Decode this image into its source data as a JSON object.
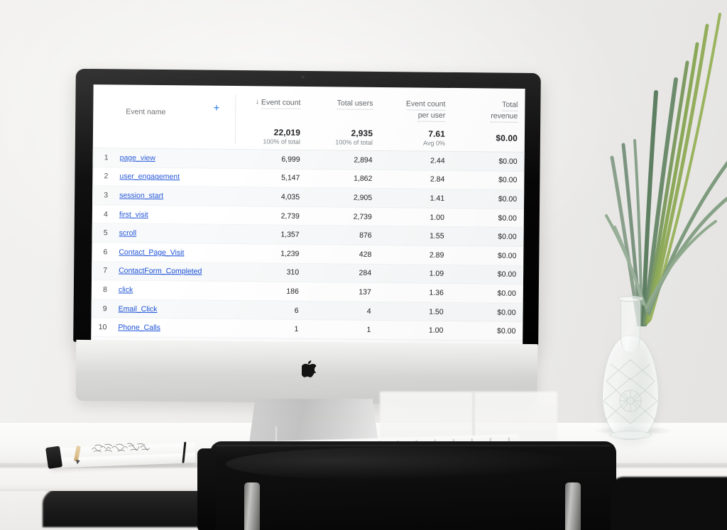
{
  "scene": {
    "device": "imac-desktop-computer",
    "wall_color": "#eeedeb",
    "desk_color": "#f7f6f5"
  },
  "report": {
    "columns": [
      {
        "key": "event_name",
        "label": "Event name",
        "align": "left",
        "sorted": false,
        "dotted_underline": false
      },
      {
        "key": "event_count",
        "label": "Event count",
        "align": "right",
        "sorted": true,
        "sort_direction": "desc",
        "sort_glyph": "↓",
        "dotted_underline": true
      },
      {
        "key": "total_users",
        "label": "Total users",
        "align": "right",
        "sorted": false,
        "dotted_underline": true
      },
      {
        "key": "event_count_per_user",
        "label_line1": "Event count",
        "label_line2": "per user",
        "align": "right",
        "sorted": false,
        "dotted_underline": true
      },
      {
        "key": "total_revenue",
        "label_line1": "Total",
        "label_line2": "revenue",
        "align": "right",
        "sorted": false,
        "dotted_underline": true
      }
    ],
    "add_column_icon": "plus-icon",
    "add_column_color": "#1a73e8",
    "summary": {
      "event_count": {
        "value": "22,019",
        "sub": "100% of total"
      },
      "total_users": {
        "value": "2,935",
        "sub": "100% of total"
      },
      "event_count_per_user": {
        "value": "7.61",
        "sub": "Avg 0%"
      },
      "total_revenue": {
        "value": "$0.00",
        "sub": ""
      }
    },
    "rows": [
      {
        "index": "1",
        "event_name": "page_view",
        "event_count": "6,999",
        "total_users": "2,894",
        "event_count_per_user": "2.44",
        "total_revenue": "$0.00"
      },
      {
        "index": "2",
        "event_name": "user_engagement",
        "event_count": "5,147",
        "total_users": "1,862",
        "event_count_per_user": "2.84",
        "total_revenue": "$0.00"
      },
      {
        "index": "3",
        "event_name": "session_start",
        "event_count": "4,035",
        "total_users": "2,905",
        "event_count_per_user": "1.41",
        "total_revenue": "$0.00"
      },
      {
        "index": "4",
        "event_name": "first_visit",
        "event_count": "2,739",
        "total_users": "2,739",
        "event_count_per_user": "1.00",
        "total_revenue": "$0.00"
      },
      {
        "index": "5",
        "event_name": "scroll",
        "event_count": "1,357",
        "total_users": "876",
        "event_count_per_user": "1.55",
        "total_revenue": "$0.00"
      },
      {
        "index": "6",
        "event_name": "Contact_Page_Visit",
        "event_count": "1,239",
        "total_users": "428",
        "event_count_per_user": "2.89",
        "total_revenue": "$0.00"
      },
      {
        "index": "7",
        "event_name": "ContactForm_Completed",
        "event_count": "310",
        "total_users": "284",
        "event_count_per_user": "1.09",
        "total_revenue": "$0.00"
      },
      {
        "index": "8",
        "event_name": "click",
        "event_count": "186",
        "total_users": "137",
        "event_count_per_user": "1.36",
        "total_revenue": "$0.00"
      },
      {
        "index": "9",
        "event_name": "Email_Click",
        "event_count": "6",
        "total_users": "4",
        "event_count_per_user": "1.50",
        "total_revenue": "$0.00"
      },
      {
        "index": "10",
        "event_name": "Phone_Calls",
        "event_count": "1",
        "total_users": "1",
        "event_count_per_user": "1.00",
        "total_revenue": "$0.00"
      }
    ],
    "link_color": "#1a4fd6"
  }
}
